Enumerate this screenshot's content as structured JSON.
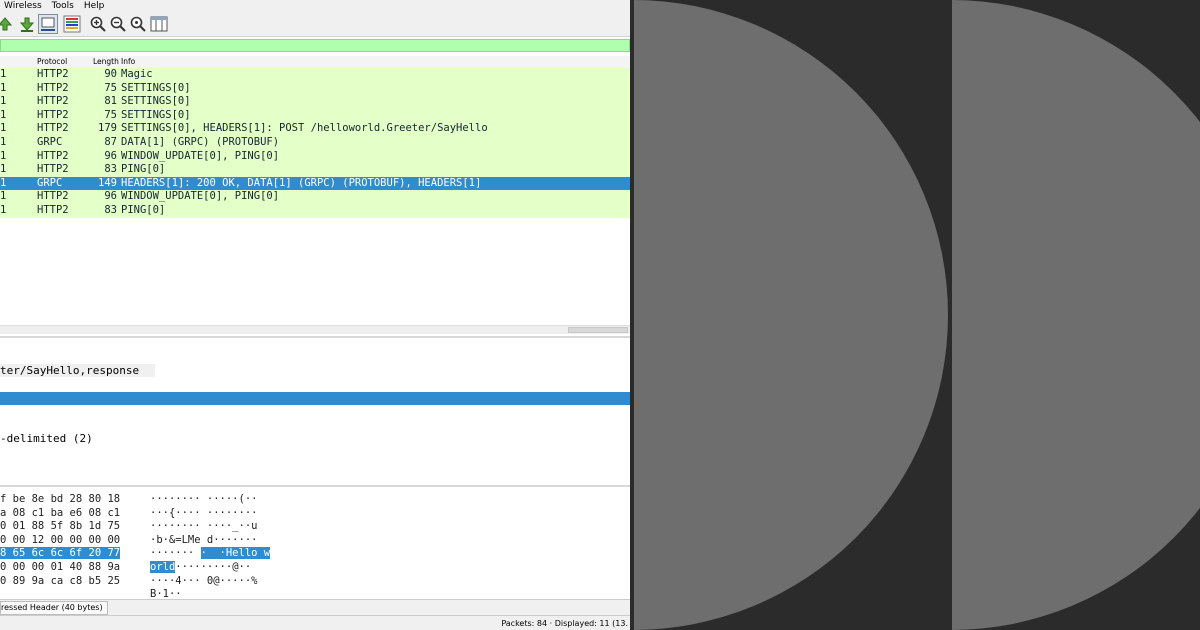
{
  "menu": [
    "Wireless",
    "Tools",
    "Help"
  ],
  "icons": [
    "go-first-icon",
    "go-last-icon",
    "autoscroll-icon",
    "colorize-icon",
    "zoom-in-icon",
    "zoom-out-icon",
    "zoom-reset-icon",
    "resize-columns-icon"
  ],
  "columns": {
    "protocol": "Protocol",
    "length": "Length",
    "info": "Info"
  },
  "packets": [
    {
      "no": "1",
      "protocol": "HTTP2",
      "length": "90",
      "info": "Magic"
    },
    {
      "no": "1",
      "protocol": "HTTP2",
      "length": "75",
      "info": "SETTINGS[0]"
    },
    {
      "no": "1",
      "protocol": "HTTP2",
      "length": "81",
      "info": "SETTINGS[0]"
    },
    {
      "no": "1",
      "protocol": "HTTP2",
      "length": "75",
      "info": "SETTINGS[0]"
    },
    {
      "no": "1",
      "protocol": "HTTP2",
      "length": "179",
      "info": "SETTINGS[0], HEADERS[1]: POST /helloworld.Greeter/SayHello"
    },
    {
      "no": "1",
      "protocol": "GRPC",
      "length": "87",
      "info": "DATA[1] (GRPC) (PROTOBUF)"
    },
    {
      "no": "1",
      "protocol": "HTTP2",
      "length": "96",
      "info": "WINDOW_UPDATE[0], PING[0]"
    },
    {
      "no": "1",
      "protocol": "HTTP2",
      "length": "83",
      "info": "PING[0]"
    },
    {
      "no": "1",
      "protocol": "GRPC",
      "length": "149",
      "info": "HEADERS[1]: 200 OK, DATA[1] (GRPC) (PROTOBUF), HEADERS[1]"
    },
    {
      "no": "1",
      "protocol": "HTTP2",
      "length": "96",
      "info": "WINDOW_UPDATE[0], PING[0]"
    },
    {
      "no": "1",
      "protocol": "HTTP2",
      "length": "83",
      "info": "PING[0]"
    }
  ],
  "selected_packet_index": 8,
  "detail": {
    "row1": "ter/SayHello,response",
    "row2": "-delimited (2)"
  },
  "bytes": [
    {
      "hex": "f be 8e bd 28 80 18",
      "ascii": "········ ·····(··",
      "hl_hex": "",
      "hl_ascii": ""
    },
    {
      "hex": "a 08 c1 ba e6 08 c1",
      "ascii": "···{···· ········",
      "hl_hex": "",
      "hl_ascii": ""
    },
    {
      "hex": "0 01 88 5f 8b 1d 75",
      "ascii": "········ ····_··u",
      "hl_hex": "",
      "hl_ascii": ""
    },
    {
      "hex": "0 00 12 00 00 00 00",
      "ascii": "·b·&=LMe d·······",
      "hl_hex": "",
      "hl_ascii": ""
    },
    {
      "hex": "",
      "ascii": "······· ",
      "hl_hex": "8 65 6c 6c 6f 20 77",
      "hl_ascii": "·  ·Hello w"
    },
    {
      "hex": "0 00 00 01 40 88 9a",
      "ascii": "·········@··",
      "hl_hex": "",
      "hl_ascii": "orld"
    },
    {
      "hex": "0 89 9a ca c8 b5 25",
      "ascii": "····4··· 0@·····%",
      "hl_hex": "",
      "hl_ascii": ""
    },
    {
      "hex": "",
      "ascii": "B·1··",
      "hl_hex": "",
      "hl_ascii": ""
    }
  ],
  "bottom_tab": "ressed Header (40 bytes)",
  "status": "Packets: 84 · Displayed: 11 (13."
}
